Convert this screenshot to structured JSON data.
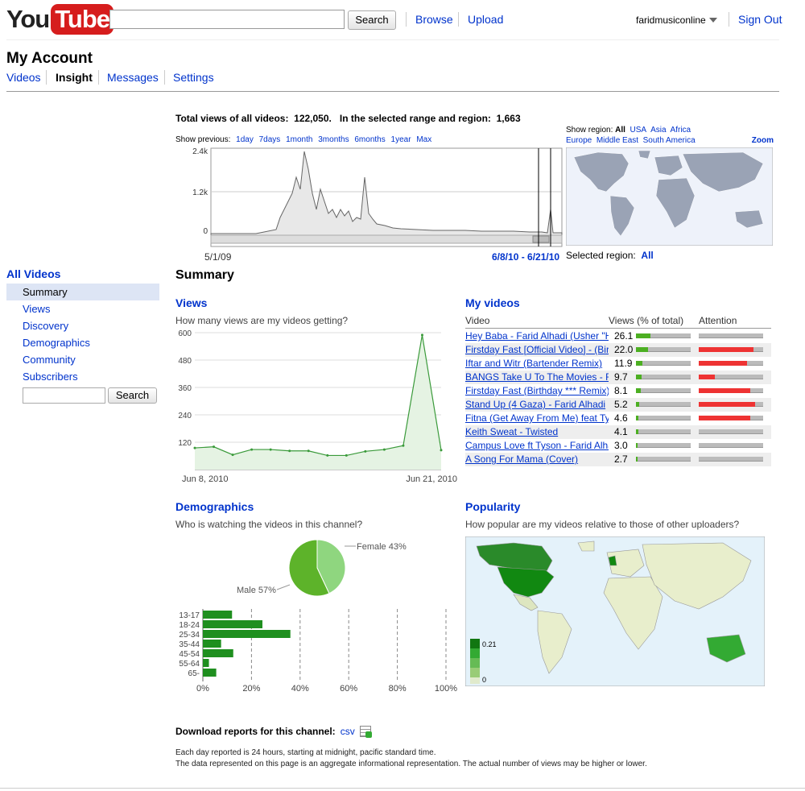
{
  "header": {
    "logo_you": "You",
    "logo_tube": "Tube",
    "search_button": "Search",
    "browse": "Browse",
    "upload": "Upload",
    "username": "faridmusiconline",
    "sign_out": "Sign Out"
  },
  "page": {
    "title": "My Account",
    "tabs": [
      {
        "label": "Videos",
        "current": false
      },
      {
        "label": "Insight",
        "current": true
      },
      {
        "label": "Messages",
        "current": false
      },
      {
        "label": "Settings",
        "current": false
      }
    ]
  },
  "sidebar": {
    "title": "All Videos",
    "items": [
      {
        "label": "Summary",
        "current": true
      },
      {
        "label": "Views"
      },
      {
        "label": "Discovery"
      },
      {
        "label": "Demographics"
      },
      {
        "label": "Community"
      },
      {
        "label": "Subscribers"
      }
    ],
    "search_button": "Search"
  },
  "stats": {
    "total_label": "Total views of all videos:",
    "total_value": "122,050.",
    "range_label": "In the selected range and region:",
    "range_value": "1,663"
  },
  "show_previous": {
    "label": "Show previous:",
    "options": [
      "1day",
      "7days",
      "1month",
      "3months",
      "6months",
      "1year",
      "Max"
    ]
  },
  "timeline": {
    "y_ticks": [
      "2.4k",
      "1.2k",
      "0"
    ],
    "start_label": "5/1/09",
    "range_label": "6/8/10 - 6/21/10"
  },
  "region": {
    "label": "Show region:",
    "options": [
      "All",
      "USA",
      "Asia",
      "Africa",
      "Europe",
      "Middle East",
      "South America"
    ],
    "zoom": "Zoom",
    "selected_label": "Selected region:",
    "selected_value": "All"
  },
  "summary_title": "Summary",
  "views": {
    "title": "Views",
    "question": "How many views are my videos getting?"
  },
  "my_videos": {
    "title": "My videos",
    "col_video": "Video",
    "col_views": "Views (% of total)",
    "col_attention": "Attention",
    "rows": [
      {
        "title": "Hey Baba - Farid Alhadi (Usher \"Hey Daddy\" Remix)",
        "pct": "26.1",
        "views": 0.261,
        "attention": 0
      },
      {
        "title": "Firstday Fast [Official Video] - (Birthday Sex Remix)",
        "pct": "22.0",
        "views": 0.22,
        "attention": 0.85
      },
      {
        "title": "Iftar and Witr (Bartender Remix)",
        "pct": "11.9",
        "views": 0.119,
        "attention": 0.75
      },
      {
        "title": "BANGS Take U To The Movies - Farid Alhadi",
        "pct": "9.7",
        "views": 0.097,
        "attention": 0.25
      },
      {
        "title": "Firstday Fast (Birthday *** Remix)",
        "pct": "8.1",
        "views": 0.081,
        "attention": 0.8
      },
      {
        "title": "Stand Up (4 Gaza) - Farid Alhadi",
        "pct": "5.2",
        "views": 0.052,
        "attention": 0.88
      },
      {
        "title": "Fitna (Get Away From Me) feat Tyson",
        "pct": "4.6",
        "views": 0.046,
        "attention": 0.8
      },
      {
        "title": "Keith Sweat - Twisted",
        "pct": "4.1",
        "views": 0.041,
        "attention": 0
      },
      {
        "title": "Campus Love ft Tyson - Farid Alhadi",
        "pct": "3.0",
        "views": 0.03,
        "attention": 0
      },
      {
        "title": "A Song For Mama (Cover)",
        "pct": "2.7",
        "views": 0.027,
        "attention": 0
      }
    ]
  },
  "demographics": {
    "title": "Demographics",
    "question": "Who is watching the videos in this channel?",
    "female_label": "Female 43%",
    "male_label": "Male 57%"
  },
  "popularity": {
    "title": "Popularity",
    "question": "How popular are my videos relative to those of other uploaders?",
    "legend_max": "0.21",
    "legend_min": "0"
  },
  "footer": {
    "download_label": "Download reports for this channel:",
    "csv": "csv",
    "note1": "Each day reported is 24 hours, starting at midnight, pacific standard time.",
    "note2": "The data represented on this page is an aggregate informational representation. The actual number of views may be higher or lower."
  },
  "colors": {
    "link": "#0033cc",
    "green": "#4caf22",
    "red": "#e33333",
    "map_highlight": "#118811",
    "map_land": "#e8eecc",
    "map_water": "#e4f2fa"
  },
  "chart_data": [
    {
      "type": "area",
      "title": "Views",
      "x": [
        "Jun 8, 2010",
        "Jun 9, 2010",
        "Jun 10, 2010",
        "Jun 11, 2010",
        "Jun 12, 2010",
        "Jun 13, 2010",
        "Jun 14, 2010",
        "Jun 15, 2010",
        "Jun 16, 2010",
        "Jun 17, 2010",
        "Jun 18, 2010",
        "Jun 19, 2010",
        "Jun 20, 2010",
        "Jun 21, 2010"
      ],
      "x_tick_labels": [
        "Jun 8, 2010",
        "Jun 21, 2010"
      ],
      "values": [
        95,
        100,
        65,
        88,
        88,
        82,
        82,
        62,
        62,
        80,
        88,
        105,
        590,
        85
      ],
      "y_ticks": [
        120,
        240,
        360,
        480,
        600
      ],
      "ylim": [
        0,
        600
      ]
    },
    {
      "type": "pie",
      "title": "Demographics",
      "labels": [
        "Female 43%",
        "Male 57%"
      ],
      "values": [
        43,
        57
      ]
    },
    {
      "type": "bar",
      "orientation": "horizontal",
      "categories": [
        "13-17",
        "18-24",
        "25-34",
        "35-44",
        "45-54",
        "55-64",
        "65-"
      ],
      "values": [
        12,
        24.5,
        36,
        7.5,
        12.5,
        2.5,
        5.5
      ],
      "x_ticks": [
        "0%",
        "20%",
        "40%",
        "60%",
        "80%",
        "100%"
      ],
      "xlim": [
        0,
        100
      ]
    }
  ]
}
